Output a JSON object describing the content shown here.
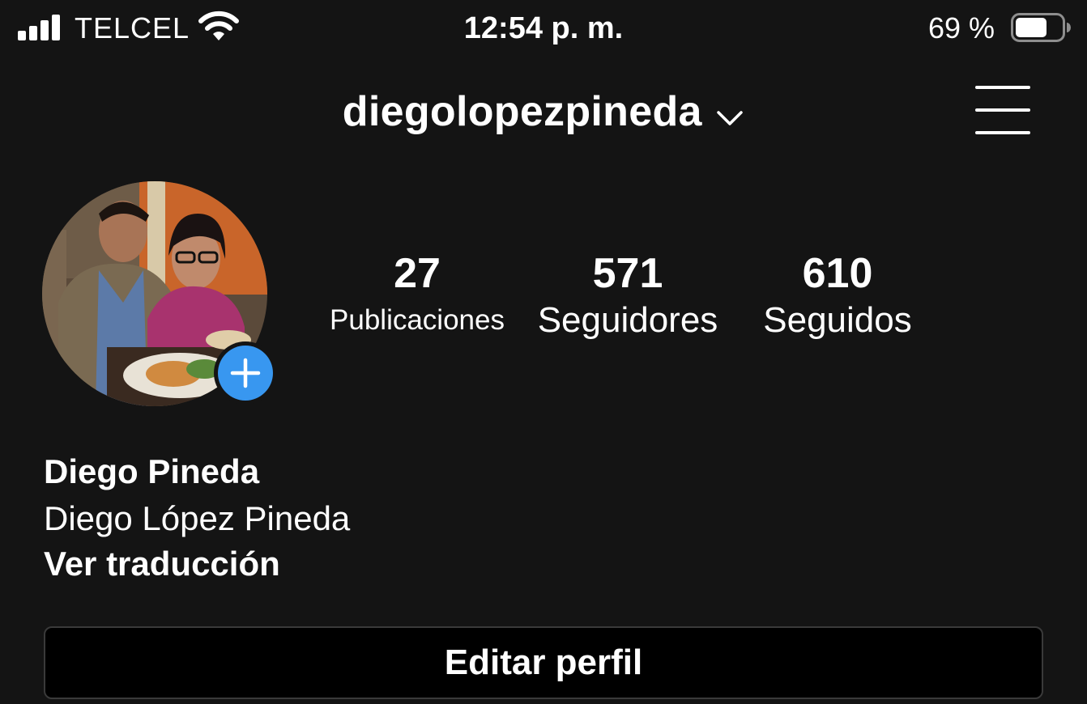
{
  "status_bar": {
    "carrier": "TELCEL",
    "time": "12:54 p. m.",
    "battery_percent": "69 %",
    "battery_level": 0.69,
    "signal_bars": 4,
    "signal_icon": "signal-bars-icon",
    "wifi_icon": "wifi-icon",
    "battery_icon": "battery-icon"
  },
  "header": {
    "username": "diegolopezpineda",
    "chevron_icon": "chevron-down-icon",
    "menu_icon": "hamburger-menu-icon"
  },
  "profile": {
    "avatar_description": "profile-photo",
    "add_story_icon": "plus-icon",
    "add_story_color": "#3897f0",
    "stats": [
      {
        "value": "27",
        "label": "Publicaciones"
      },
      {
        "value": "571",
        "label": "Seguidores"
      },
      {
        "value": "610",
        "label": "Seguidos"
      }
    ],
    "name": "Diego Pineda",
    "bio": "Diego López Pineda",
    "translate_link": "Ver traducción",
    "edit_button": "Editar perfil"
  },
  "colors": {
    "background": "#141414",
    "text": "#ffffff",
    "button_bg": "#000000",
    "button_border": "#3a3a3a"
  }
}
